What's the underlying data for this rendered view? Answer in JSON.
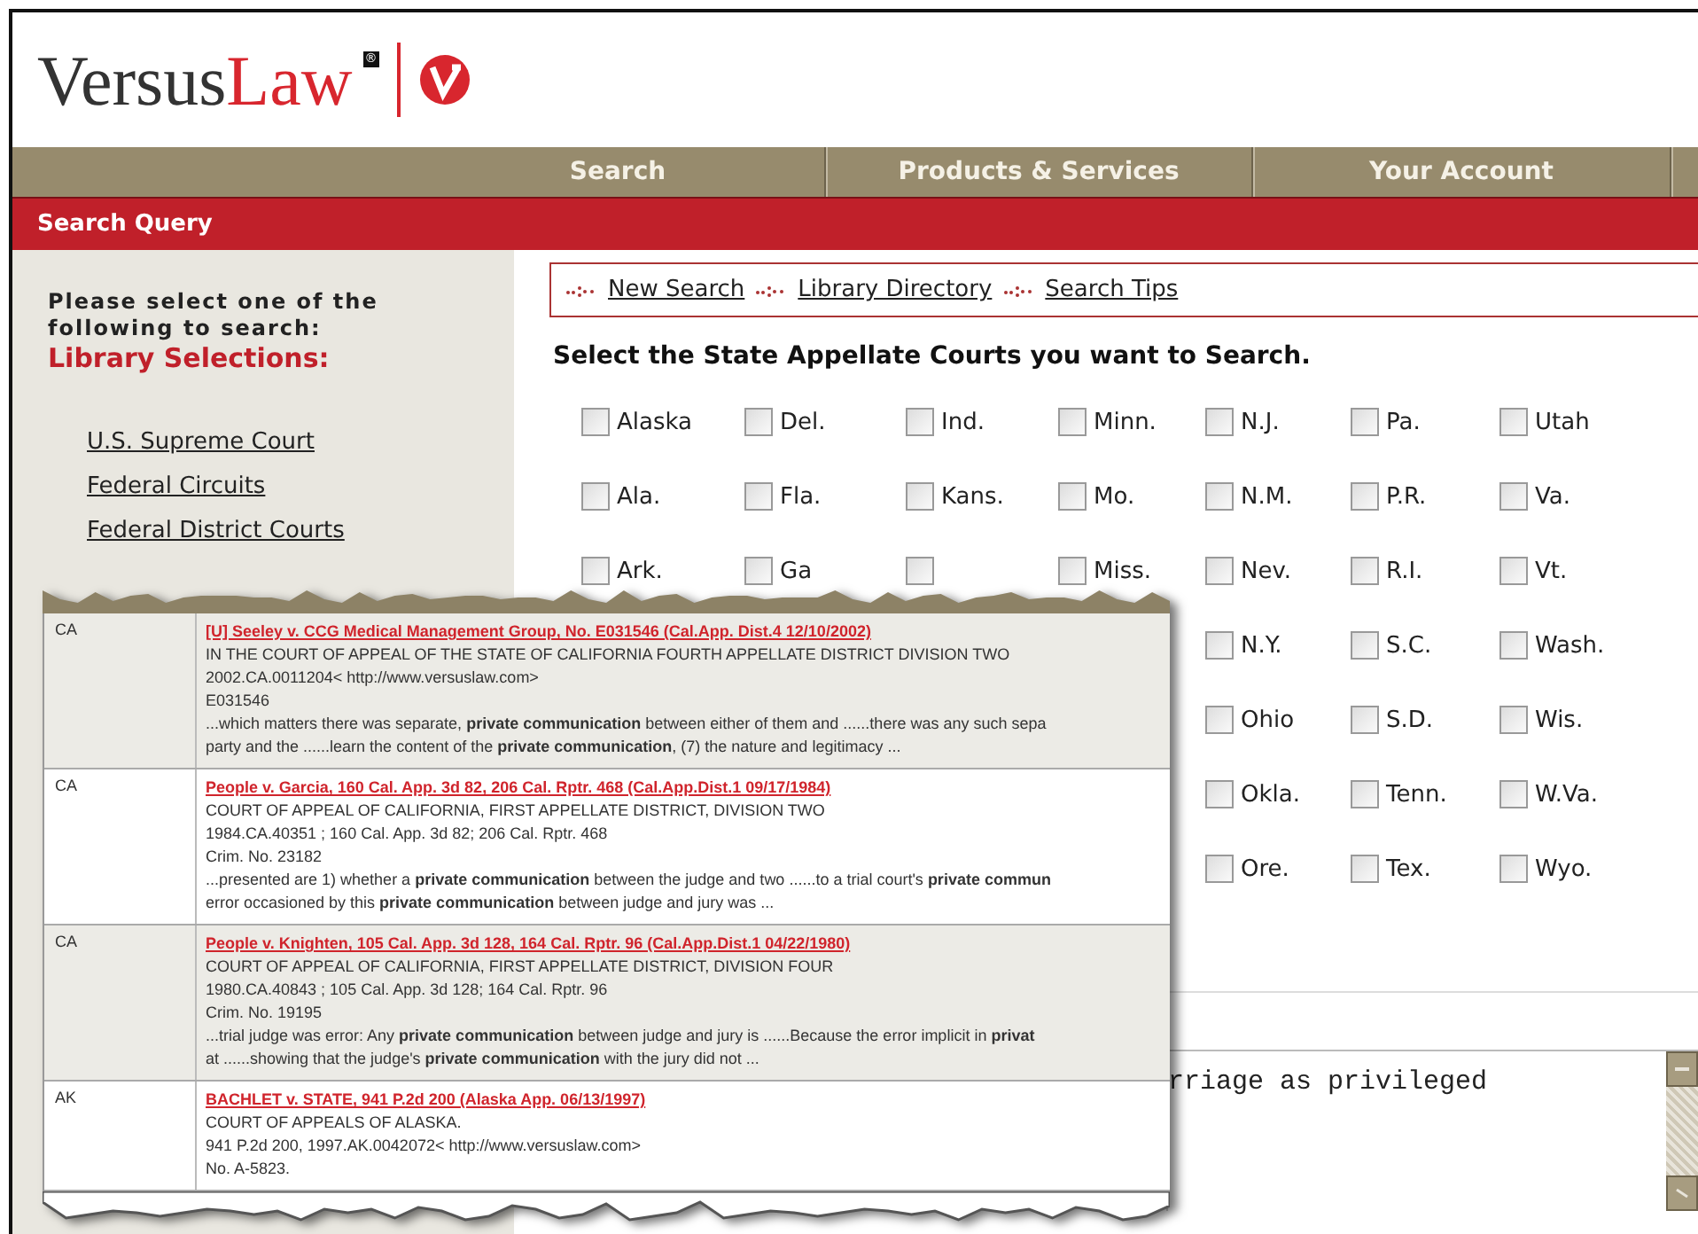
{
  "logo": {
    "name_1": "Versus",
    "name_2": "Law",
    "mark": "®"
  },
  "nav": [
    {
      "label": "Search"
    },
    {
      "label": "Products & Services"
    },
    {
      "label": "Your Account"
    }
  ],
  "section_bar": {
    "title": "Search Query"
  },
  "sidebar": {
    "intro": "Please select one of the following to search:",
    "heading": "Library Selections:",
    "links": [
      "U.S. Supreme Court",
      "Federal Circuits",
      "Federal District Courts"
    ]
  },
  "tool_links": [
    "New Search",
    "Library Directory",
    "Search Tips"
  ],
  "courts": {
    "heading": "Select the State Appellate Courts you want to Search.",
    "rows": [
      [
        {
          "label": "Alaska",
          "checked": false
        },
        {
          "label": "Del.",
          "checked": false
        },
        {
          "label": "Ind.",
          "checked": false
        },
        {
          "label": "Minn.",
          "checked": false
        },
        {
          "label": "N.J.",
          "checked": false
        },
        {
          "label": "Pa.",
          "checked": false
        },
        {
          "label": "Utah",
          "checked": false
        }
      ],
      [
        {
          "label": "Ala.",
          "checked": false
        },
        {
          "label": "Fla.",
          "checked": false
        },
        {
          "label": "Kans.",
          "checked": false
        },
        {
          "label": "Mo.",
          "checked": false
        },
        {
          "label": "N.M.",
          "checked": false
        },
        {
          "label": "P.R.",
          "checked": false
        },
        {
          "label": "Va.",
          "checked": false
        }
      ],
      [
        {
          "label": "Ark.",
          "checked": false
        },
        {
          "label": "Ga",
          "checked": false
        },
        {
          "checked": false
        },
        {
          "label": "Miss.",
          "checked": false
        },
        {
          "label": "Nev.",
          "checked": false
        },
        {
          "label": "R.I.",
          "checked": false
        },
        {
          "label": "Vt.",
          "checked": false
        }
      ],
      [
        {
          "label": "N.Y.",
          "checked": false
        },
        {
          "label": "S.C.",
          "checked": false
        },
        {
          "label": "Wash.",
          "checked": false
        }
      ],
      [
        {
          "label": "Ohio",
          "checked": false
        },
        {
          "label": "S.D.",
          "checked": false
        },
        {
          "label": "Wis.",
          "checked": false
        }
      ],
      [
        {
          "label": "Okla.",
          "checked": false
        },
        {
          "label": "Tenn.",
          "checked": false
        },
        {
          "label": "W.Va.",
          "checked": false
        }
      ],
      [
        {
          "label": "Ore.",
          "checked": false
        },
        {
          "label": "Tex.",
          "checked": false
        },
        {
          "label": "Wyo.",
          "checked": false
        }
      ]
    ]
  },
  "query": {
    "value": "rriage as privileged"
  },
  "results": [
    {
      "jurisdiction": "CA",
      "title": "[U] Seeley v. CCG Medical Management Group, No. E031546 (Cal.App. Dist.4 12/10/2002)",
      "lines": [
        "IN THE COURT OF APPEAL OF THE STATE OF CALIFORNIA FOURTH APPELLATE DISTRICT DIVISION TWO",
        "2002.CA.0011204< http://www.versuslaw.com>",
        "E031546",
        "...which matters there was separate, **private communication** between either of them and ......there was any such sepa",
        "party and the ......learn the content of the **private communication**, (7) the nature and legitimacy ..."
      ]
    },
    {
      "jurisdiction": "CA",
      "title": "People v. Garcia, 160 Cal. App. 3d 82, 206 Cal. Rptr. 468 (Cal.App.Dist.1 09/17/1984)",
      "lines": [
        "COURT OF APPEAL OF CALIFORNIA, FIRST APPELLATE DISTRICT, DIVISION TWO",
        "1984.CA.40351 ; 160 Cal. App. 3d 82; 206 Cal. Rptr. 468",
        "Crim. No. 23182",
        "...presented are 1) whether a **private communication** between the judge and two ......to a trial court's **private commun**",
        "error occasioned by this **private communication** between judge and jury was ..."
      ]
    },
    {
      "jurisdiction": "CA",
      "title": "People v. Knighten, 105 Cal. App. 3d 128, 164 Cal. Rptr. 96 (Cal.App.Dist.1 04/22/1980)",
      "lines": [
        "COURT OF APPEAL OF CALIFORNIA, FIRST APPELLATE DISTRICT, DIVISION FOUR",
        "1980.CA.40843 ; 105 Cal. App. 3d 128; 164 Cal. Rptr. 96",
        "Crim. No. 19195",
        "...trial judge was error: Any **private communication** between judge and jury is ......Because the error implicit in **privat**",
        "at ......showing that the judge's **private communication** with the jury did not ..."
      ]
    },
    {
      "jurisdiction": "AK",
      "title": "BACHLET v. STATE, 941 P.2d 200 (Alaska App. 06/13/1997)",
      "lines": [
        "COURT OF APPEALS OF ALASKA.",
        "941 P.2d 200, 1997.AK.0042072< http://www.versuslaw.com>",
        "No. A-5823."
      ]
    }
  ]
}
